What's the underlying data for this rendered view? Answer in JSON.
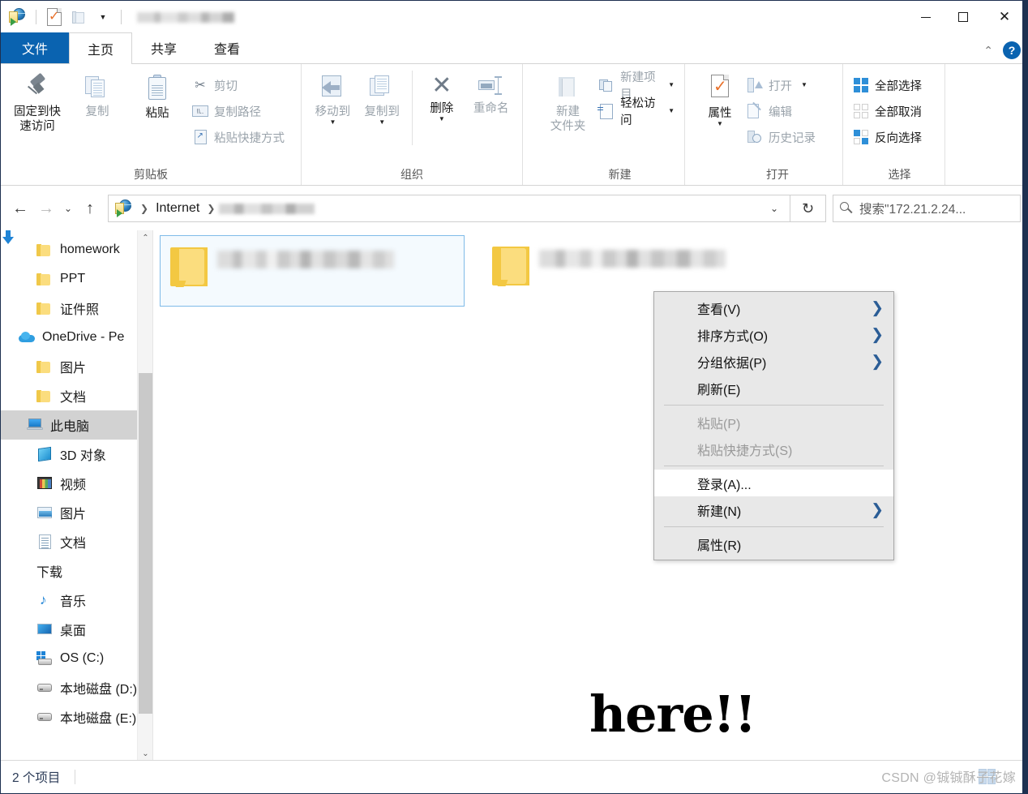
{
  "window": {
    "title_blurred": true,
    "quick_access": [
      {
        "name": "internet-explorer-icon",
        "label": "Internet"
      },
      {
        "name": "properties-check-icon",
        "label": "属性"
      },
      {
        "name": "new-folder-icon",
        "label": "新建文件夹"
      },
      {
        "name": "customize-caret-icon",
        "label": "▼"
      }
    ],
    "controls": {
      "minimize": "—",
      "maximize": "☐",
      "close": "✕"
    }
  },
  "tabs": {
    "file": "文件",
    "items": [
      {
        "label": "主页",
        "active": true
      },
      {
        "label": "共享",
        "active": false
      },
      {
        "label": "查看",
        "active": false
      }
    ],
    "collapse_ribbon": "⌃",
    "help": "?"
  },
  "ribbon": {
    "groups": [
      {
        "label": "剪贴板",
        "big": [
          {
            "icon": "pin-icon",
            "label": "固定到快\n速访问",
            "line1": "固定到快",
            "line2": "速访问",
            "dim": false
          },
          {
            "icon": "copy-icon",
            "label": "复制",
            "dim": true
          },
          {
            "icon": "paste-icon",
            "label": "粘贴",
            "dim": false
          }
        ],
        "small": [
          {
            "icon": "scissors-icon",
            "label": "剪切",
            "dim": true
          },
          {
            "icon": "copy-path-icon",
            "label": "复制路径",
            "dim": true
          },
          {
            "icon": "paste-shortcut-icon",
            "label": "粘贴快捷方式",
            "dim": true
          }
        ]
      },
      {
        "label": "组织",
        "big": [
          {
            "icon": "move-to-icon",
            "label": "移动到",
            "dim": true,
            "caret": true
          },
          {
            "icon": "copy-to-icon",
            "label": "复制到",
            "dim": true,
            "caret": true
          },
          {
            "icon": "delete-icon",
            "label": "删除",
            "dim": false,
            "caret": true
          },
          {
            "icon": "rename-icon",
            "label": "重命名",
            "dim": true
          }
        ]
      },
      {
        "label": "新建",
        "big": [
          {
            "icon": "new-folder-icon",
            "line1": "新建",
            "line2": "文件夹",
            "label": "新建文件夹",
            "dim": true
          }
        ],
        "small": [
          {
            "icon": "new-item-icon",
            "label": "新建项目",
            "dim": true,
            "caret": true
          },
          {
            "icon": "easy-access-icon",
            "label": "轻松访问",
            "dim": false,
            "caret": true
          }
        ]
      },
      {
        "label": "打开",
        "big": [
          {
            "icon": "properties-icon",
            "label": "属性",
            "dim": false,
            "caret": true
          }
        ],
        "small": [
          {
            "icon": "open-icon",
            "label": "打开",
            "dim": true,
            "caret": true
          },
          {
            "icon": "edit-icon",
            "label": "编辑",
            "dim": true
          },
          {
            "icon": "history-icon",
            "label": "历史记录",
            "dim": true
          }
        ]
      },
      {
        "label": "选择",
        "small": [
          {
            "icon": "select-all-icon",
            "label": "全部选择",
            "dim": false
          },
          {
            "icon": "select-none-icon",
            "label": "全部取消",
            "dim": false
          },
          {
            "icon": "invert-selection-icon",
            "label": "反向选择",
            "dim": false
          }
        ]
      }
    ]
  },
  "address": {
    "back": "←",
    "forward": "→",
    "recent": "⌄",
    "up": "↑",
    "crumbs": [
      {
        "label": "Internet",
        "blurred": false
      },
      {
        "label": "",
        "blurred": true
      }
    ],
    "dropdown": "⌄",
    "refresh": "↻"
  },
  "search": {
    "icon": "search-icon",
    "placeholder": "搜索\"172.21.2.24..."
  },
  "nav_pane": {
    "items": [
      {
        "label": "homework",
        "icon": "folder-icon",
        "level": 2,
        "selected": false
      },
      {
        "label": "PPT",
        "icon": "folder-icon",
        "level": 2,
        "selected": false
      },
      {
        "label": "证件照",
        "icon": "folder-icon",
        "level": 2,
        "selected": false
      },
      {
        "label": "OneDrive - Pe",
        "icon": "onedrive-icon",
        "level": 1,
        "selected": false
      },
      {
        "label": "图片",
        "icon": "folder-icon",
        "level": 2,
        "selected": false
      },
      {
        "label": "文档",
        "icon": "folder-icon",
        "level": 2,
        "selected": false
      },
      {
        "label": "此电脑",
        "icon": "this-pc-icon",
        "level": 1,
        "selected": true
      },
      {
        "label": "3D 对象",
        "icon": "3d-objects-icon",
        "level": 2,
        "selected": false
      },
      {
        "label": "视频",
        "icon": "videos-icon",
        "level": 2,
        "selected": false
      },
      {
        "label": "图片",
        "icon": "pictures-icon",
        "level": 2,
        "selected": false
      },
      {
        "label": "文档",
        "icon": "documents-icon",
        "level": 2,
        "selected": false
      },
      {
        "label": "下载",
        "icon": "downloads-icon",
        "level": 2,
        "selected": false
      },
      {
        "label": "音乐",
        "icon": "music-icon",
        "level": 2,
        "selected": false
      },
      {
        "label": "桌面",
        "icon": "desktop-icon",
        "level": 2,
        "selected": false
      },
      {
        "label": "OS (C:)",
        "icon": "os-drive-icon",
        "level": 2,
        "selected": false
      },
      {
        "label": "本地磁盘 (D:)",
        "icon": "drive-icon",
        "level": 2,
        "selected": false
      },
      {
        "label": "本地磁盘 (E:)",
        "icon": "drive-icon",
        "level": 2,
        "selected": false
      }
    ],
    "scroll_up": "⌃",
    "scroll_down": "⌄"
  },
  "files": [
    {
      "name": "",
      "blurred": true,
      "selected": true,
      "icon": "folder-icon"
    },
    {
      "name": "",
      "blurred": true,
      "selected": false,
      "icon": "folder-icon"
    }
  ],
  "annotation": {
    "text": "here!!"
  },
  "context_menu": {
    "items": [
      {
        "label": "查看(V)",
        "submenu": true,
        "disabled": false,
        "hover": false,
        "separator_after": false
      },
      {
        "label": "排序方式(O)",
        "submenu": true,
        "disabled": false,
        "hover": false,
        "separator_after": false
      },
      {
        "label": "分组依据(P)",
        "submenu": true,
        "disabled": false,
        "hover": false,
        "separator_after": false
      },
      {
        "label": "刷新(E)",
        "submenu": false,
        "disabled": false,
        "hover": false,
        "separator_after": true
      },
      {
        "label": "粘贴(P)",
        "submenu": false,
        "disabled": true,
        "hover": false,
        "separator_after": false
      },
      {
        "label": "粘贴快捷方式(S)",
        "submenu": false,
        "disabled": true,
        "hover": false,
        "separator_after": true
      },
      {
        "label": "登录(A)...",
        "submenu": false,
        "disabled": false,
        "hover": true,
        "separator_after": false
      },
      {
        "label": "新建(N)",
        "submenu": true,
        "disabled": false,
        "hover": false,
        "separator_after": true
      },
      {
        "label": "属性(R)",
        "submenu": false,
        "disabled": false,
        "hover": false,
        "separator_after": false
      }
    ],
    "submenu_arrow": "❯"
  },
  "status_bar": {
    "item_count": "2 个项目"
  },
  "watermark": {
    "text": "CSDN @铖铖酥子花嫁"
  },
  "colors": {
    "accent": "#0a63b0",
    "selection": "#d2d2d2",
    "file_selection_border": "#7fbbe8",
    "menu_bg": "#e8e8e8",
    "submenu_arrow": "#2b5d96",
    "status_text": "#2a3a56",
    "folder_yellow": "#fbdd7e"
  }
}
